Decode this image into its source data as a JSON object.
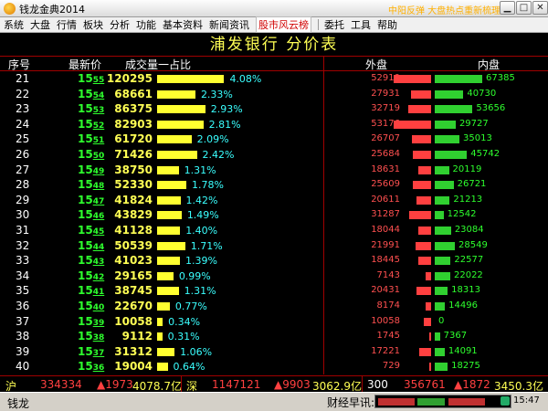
{
  "window": {
    "title": "钱龙金典2014",
    "banner": "中阳反弹 大盘热点重新梳理"
  },
  "menu": [
    "系统",
    "大盘",
    "行情",
    "板块",
    "分析",
    "功能",
    "基本资料",
    "新闻资讯",
    "股市风云榜",
    "委托",
    "工具",
    "帮助"
  ],
  "menu_active": "股市风云榜",
  "page_title": "浦发银行   分价表",
  "columns": {
    "no": "序号",
    "price": "最新价",
    "vol": "成交量一占比",
    "out": "外盘",
    "in": "内盘"
  },
  "rows": [
    {
      "no": "21",
      "price_main": "15",
      "price_dec": "55",
      "vol": "120295",
      "pct": "4.08%",
      "pct_val": 4.08,
      "out": "52910",
      "in": "67385"
    },
    {
      "no": "22",
      "price_main": "15",
      "price_dec": "54",
      "vol": "68661",
      "pct": "2.33%",
      "pct_val": 2.33,
      "out": "27931",
      "in": "40730"
    },
    {
      "no": "23",
      "price_main": "15",
      "price_dec": "53",
      "vol": "86375",
      "pct": "2.93%",
      "pct_val": 2.93,
      "out": "32719",
      "in": "53656"
    },
    {
      "no": "24",
      "price_main": "15",
      "price_dec": "52",
      "vol": "82903",
      "pct": "2.81%",
      "pct_val": 2.81,
      "out": "53176",
      "in": "29727"
    },
    {
      "no": "25",
      "price_main": "15",
      "price_dec": "51",
      "vol": "61720",
      "pct": "2.09%",
      "pct_val": 2.09,
      "out": "26707",
      "in": "35013"
    },
    {
      "no": "26",
      "price_main": "15",
      "price_dec": "50",
      "vol": "71426",
      "pct": "2.42%",
      "pct_val": 2.42,
      "out": "25684",
      "in": "45742"
    },
    {
      "no": "27",
      "price_main": "15",
      "price_dec": "49",
      "vol": "38750",
      "pct": "1.31%",
      "pct_val": 1.31,
      "out": "18631",
      "in": "20119"
    },
    {
      "no": "28",
      "price_main": "15",
      "price_dec": "48",
      "vol": "52330",
      "pct": "1.78%",
      "pct_val": 1.78,
      "out": "25609",
      "in": "26721"
    },
    {
      "no": "29",
      "price_main": "15",
      "price_dec": "47",
      "vol": "41824",
      "pct": "1.42%",
      "pct_val": 1.42,
      "out": "20611",
      "in": "21213"
    },
    {
      "no": "30",
      "price_main": "15",
      "price_dec": "46",
      "vol": "43829",
      "pct": "1.49%",
      "pct_val": 1.49,
      "out": "31287",
      "in": "12542"
    },
    {
      "no": "31",
      "price_main": "15",
      "price_dec": "45",
      "vol": "41128",
      "pct": "1.40%",
      "pct_val": 1.4,
      "out": "18044",
      "in": "23084"
    },
    {
      "no": "32",
      "price_main": "15",
      "price_dec": "44",
      "vol": "50539",
      "pct": "1.71%",
      "pct_val": 1.71,
      "out": "21991",
      "in": "28549"
    },
    {
      "no": "33",
      "price_main": "15",
      "price_dec": "43",
      "vol": "41023",
      "pct": "1.39%",
      "pct_val": 1.39,
      "out": "18445",
      "in": "22577"
    },
    {
      "no": "34",
      "price_main": "15",
      "price_dec": "42",
      "vol": "29165",
      "pct": "0.99%",
      "pct_val": 0.99,
      "out": "7143",
      "in": "22022"
    },
    {
      "no": "35",
      "price_main": "15",
      "price_dec": "41",
      "vol": "38745",
      "pct": "1.31%",
      "pct_val": 1.31,
      "out": "20431",
      "in": "18313"
    },
    {
      "no": "36",
      "price_main": "15",
      "price_dec": "40",
      "vol": "22670",
      "pct": "0.77%",
      "pct_val": 0.77,
      "out": "8174",
      "in": "14496"
    },
    {
      "no": "37",
      "price_main": "15",
      "price_dec": "39",
      "vol": "10058",
      "pct": "0.34%",
      "pct_val": 0.34,
      "out": "10058",
      "in": "0"
    },
    {
      "no": "38",
      "price_main": "15",
      "price_dec": "38",
      "vol": "9112",
      "pct": "0.31%",
      "pct_val": 0.31,
      "out": "1745",
      "in": "7367"
    },
    {
      "no": "39",
      "price_main": "15",
      "price_dec": "37",
      "vol": "31312",
      "pct": "1.06%",
      "pct_val": 1.06,
      "out": "17221",
      "in": "14091"
    },
    {
      "no": "40",
      "price_main": "15",
      "price_dec": "36",
      "vol": "19004",
      "pct": "0.64%",
      "pct_val": 0.64,
      "out": "729",
      "in": "18275"
    }
  ],
  "status": {
    "sh_label": "沪",
    "sh_index": "334334",
    "sh_change": "▲1973",
    "sh_amount": "4078.7亿",
    "sz_label": "深",
    "sz_index": "1147121",
    "sz_change": "▲9903",
    "sz_amount": "3062.9亿",
    "hs300_label": "300",
    "hs300_index": "356761",
    "hs300_change": "▲1872",
    "hs300_amount": "3450.3亿"
  },
  "bottom": {
    "brand": "钱龙",
    "news": "财经早讯:",
    "time": "15:47"
  },
  "colors": {
    "up": "#ff4040",
    "down": "#2eff2e",
    "accent": "#ffff54",
    "grid": "#a00000"
  }
}
